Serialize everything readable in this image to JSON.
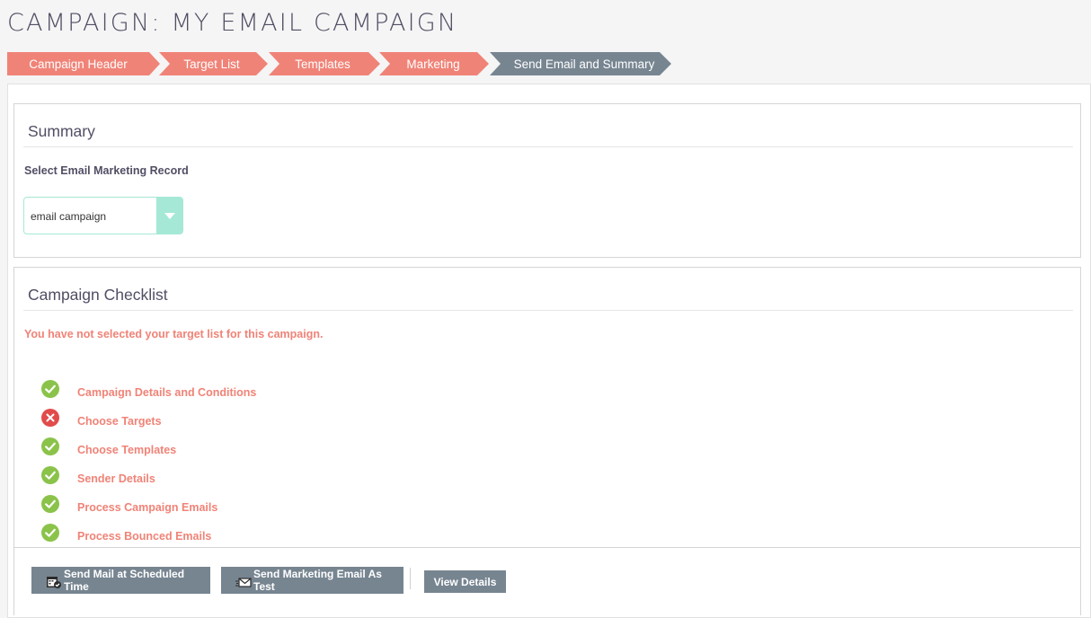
{
  "page": {
    "title": "CAMPAIGN: MY EMAIL CAMPAIGN"
  },
  "wizard": {
    "steps": [
      {
        "label": "Campaign Header",
        "state": "done"
      },
      {
        "label": "Target List",
        "state": "done"
      },
      {
        "label": "Templates",
        "state": "done"
      },
      {
        "label": "Marketing",
        "state": "done"
      },
      {
        "label": "Send Email and Summary",
        "state": "active"
      }
    ]
  },
  "summary": {
    "title": "Summary",
    "field_label": "Select Email Marketing Record",
    "select_value": "email campaign"
  },
  "checklist": {
    "title": "Campaign Checklist",
    "warning": "You have not selected your target list for this campaign.",
    "items": [
      {
        "label": "Campaign Details and Conditions",
        "status": "ok",
        "icon": "check-circle-icon"
      },
      {
        "label": "Choose Targets",
        "status": "error",
        "icon": "x-circle-icon"
      },
      {
        "label": "Choose Templates",
        "status": "ok",
        "icon": "check-circle-icon"
      },
      {
        "label": "Sender Details",
        "status": "ok",
        "icon": "check-circle-icon"
      },
      {
        "label": "Process Campaign Emails",
        "status": "ok",
        "icon": "check-circle-icon"
      },
      {
        "label": "Process Bounced Emails",
        "status": "ok",
        "icon": "check-circle-icon"
      }
    ]
  },
  "actions": {
    "send_scheduled": "Send Mail at Scheduled Time",
    "send_test": "Send Marketing Email As Test",
    "view_details": "View Details"
  },
  "colors": {
    "accent": "#f08377",
    "active_step": "#778591",
    "ok": "#8bc34a",
    "error": "#e24b4b",
    "select_accent": "#a5e8d6"
  }
}
